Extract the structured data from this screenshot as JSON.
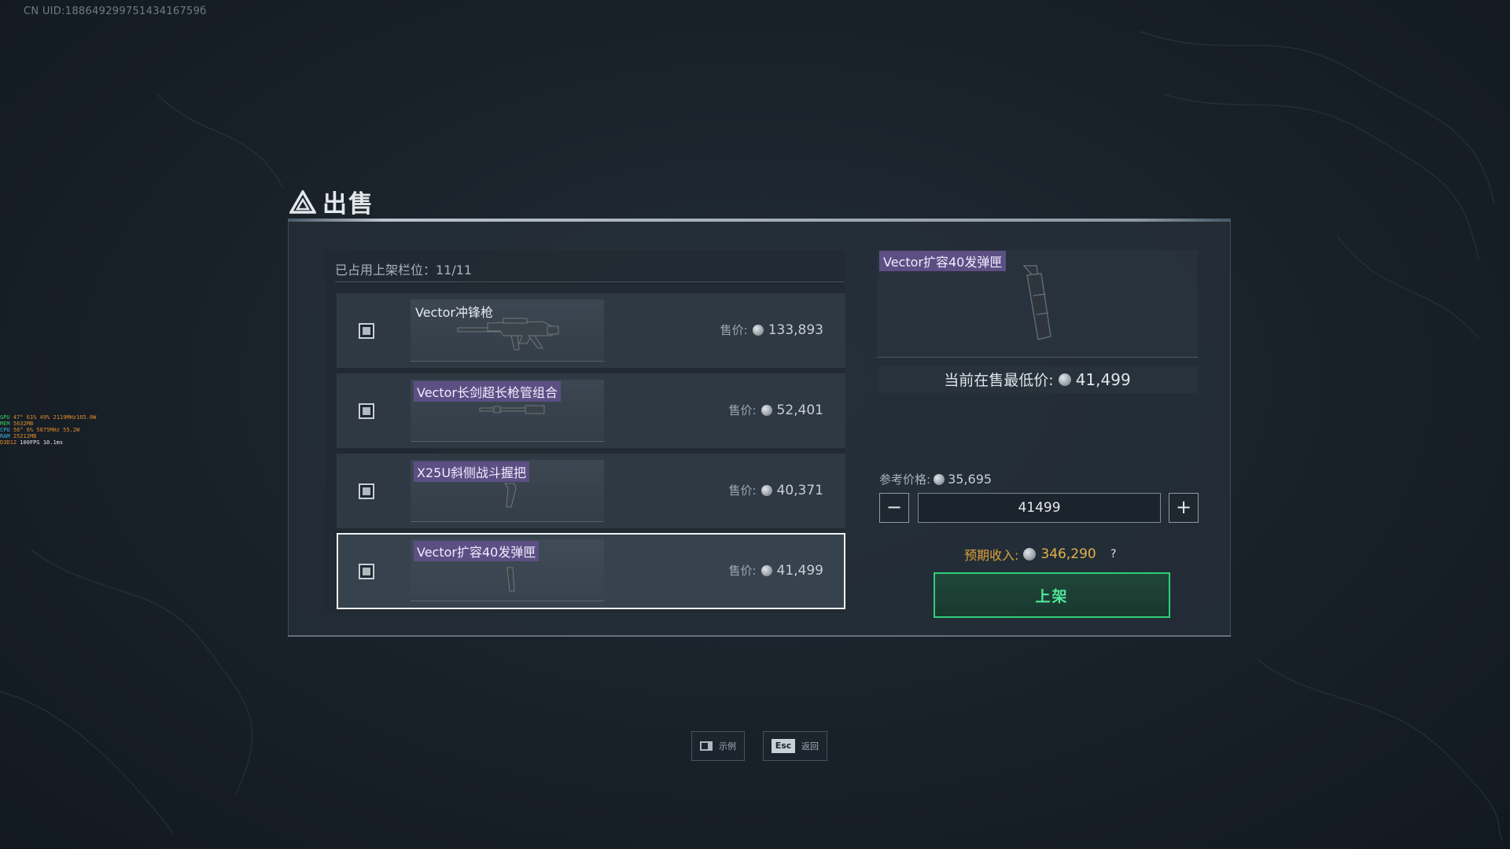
{
  "uid_text": "CN UID:18864929975143416759б",
  "perf_overlay": {
    "rows": [
      {
        "label": "GPU",
        "v1": "47°",
        "v2": "61%",
        "v3": "49%",
        "v4": "2119MHz165.0W"
      },
      {
        "label": "MEM",
        "v1": "5632MB"
      },
      {
        "label": "CPU",
        "v1": "56°",
        "v2": "6%",
        "v3": "5875MHz 55.2W"
      },
      {
        "label": "RAM",
        "v1": "25212MB"
      },
      {
        "label": "D3D12",
        "v1": "100FPS",
        "v2": "10.1ms"
      }
    ]
  },
  "header": {
    "title": "出售"
  },
  "slots": {
    "label": "已占用上架栏位：11/11",
    "items": [
      {
        "name": "Vector冲锋枪",
        "price_label": "售价:",
        "price": "133,893",
        "tagged": false
      },
      {
        "name": "Vector长剑超长枪管组合",
        "price_label": "售价:",
        "price": "52,401",
        "tagged": true
      },
      {
        "name": "X25U斜侧战斗握把",
        "price_label": "售价:",
        "price": "40,371",
        "tagged": true
      },
      {
        "name": "Vector扩容40发弹匣",
        "price_label": "售价:",
        "price": "41,499",
        "tagged": true,
        "selected": true
      }
    ]
  },
  "detail": {
    "item_name": "Vector扩容40发弹匣",
    "lowest_label": "当前在售最低价:",
    "lowest_value": "41,499",
    "ref_label": "参考价格:",
    "ref_value": "35,695",
    "minus": "−",
    "plus": "+",
    "price_input_value": "41499",
    "income_label": "预期收入:",
    "income_value": "346,290",
    "help": "?",
    "list_button": "上架"
  },
  "hints": [
    {
      "icon": "book-icon",
      "label": "示例"
    },
    {
      "key": "Esc",
      "label": "返回"
    }
  ],
  "colors": {
    "accent_green": "#2fcf7a",
    "tag_purple": "#5c4f83",
    "income_gold": "#e3b24c"
  }
}
